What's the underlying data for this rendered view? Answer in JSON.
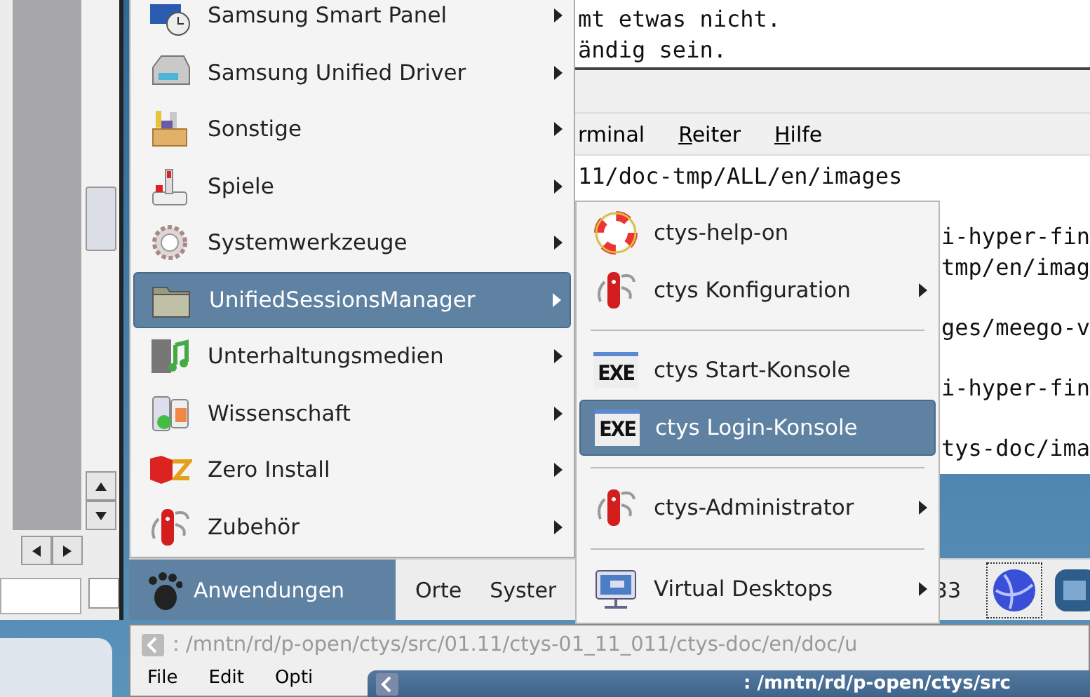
{
  "terminal": {
    "top_lines": [
      "mt etwas nicht.",
      "ändig sein."
    ],
    "menu": [
      {
        "label": "rminal",
        "mnemonic_first": false
      },
      {
        "label": "Reiter",
        "mnemonic_first": true
      },
      {
        "label": "Hilfe",
        "mnemonic_first": true
      }
    ],
    "lines": [
      {
        "text": "11/doc-tmp/ALL/en/images",
        "blank_line_before": false,
        "covered_by_menu": false
      },
      {
        "text": "i-hyper-fin",
        "blank_line_before": true,
        "covered_by_menu": true
      },
      {
        "text": "tmp/en/imag",
        "blank_line_before": false,
        "covered_by_menu": true
      },
      {
        "text": "ges/meego-v",
        "blank_line_before": true,
        "covered_by_menu": true
      },
      {
        "text": "i-hyper-fin",
        "blank_line_before": true,
        "covered_by_menu": true
      },
      {
        "text": "tys-doc/ima",
        "blank_line_before": true,
        "covered_by_menu": true
      }
    ]
  },
  "left_window": {
    "checkbox": {
      "checked": false
    }
  },
  "applications_menu": {
    "items": [
      {
        "label": "Samsung Smart Panel",
        "has_submenu": true,
        "selected": false
      },
      {
        "label": "Samsung Unified Driver",
        "has_submenu": true,
        "selected": false
      },
      {
        "label": "Sonstige",
        "has_submenu": true,
        "selected": false
      },
      {
        "label": "Spiele",
        "has_submenu": true,
        "selected": false
      },
      {
        "label": "Systemwerkzeuge",
        "has_submenu": true,
        "selected": false
      },
      {
        "label": "UnifiedSessionsManager",
        "has_submenu": true,
        "selected": true
      },
      {
        "label": "Unterhaltungsmedien",
        "has_submenu": true,
        "selected": false
      },
      {
        "label": "Wissenschaft",
        "has_submenu": true,
        "selected": false
      },
      {
        "label": "Zero Install",
        "has_submenu": true,
        "selected": false
      },
      {
        "label": "Zubehör",
        "has_submenu": true,
        "selected": false
      }
    ]
  },
  "submenu": {
    "items": [
      {
        "kind": "item",
        "label": "ctys-help-on",
        "has_submenu": false,
        "selected": false
      },
      {
        "kind": "item",
        "label": "ctys Konfiguration",
        "has_submenu": true,
        "selected": false
      },
      {
        "kind": "separator"
      },
      {
        "kind": "exe_item",
        "icon_text": "EXE",
        "label": "ctys Start-Konsole",
        "has_submenu": false,
        "selected": false
      },
      {
        "kind": "exe_item",
        "icon_text": "EXE",
        "label": "ctys Login-Konsole",
        "has_submenu": false,
        "selected": true
      },
      {
        "kind": "separator"
      },
      {
        "kind": "item",
        "label": "ctys-Administrator",
        "has_submenu": true,
        "selected": false
      },
      {
        "kind": "separator"
      },
      {
        "kind": "item",
        "label": "Virtual Desktops",
        "has_submenu": true,
        "selected": false
      }
    ]
  },
  "panel": {
    "menus": [
      {
        "label": "Anwendungen",
        "selected": true
      },
      {
        "label": "Orte",
        "selected": false
      },
      {
        "label": "Syster",
        "selected": false
      }
    ],
    "clock": "33"
  },
  "back_window": {
    "title": ": /mntn/rd/p-open/ctys/src/01.11/ctys-01_11_011/ctys-doc/en/doc/u",
    "menu": [
      "File",
      "Edit",
      "Opti"
    ]
  },
  "front_window": {
    "title": ": /mntn/rd/p-open/ctys/src"
  }
}
